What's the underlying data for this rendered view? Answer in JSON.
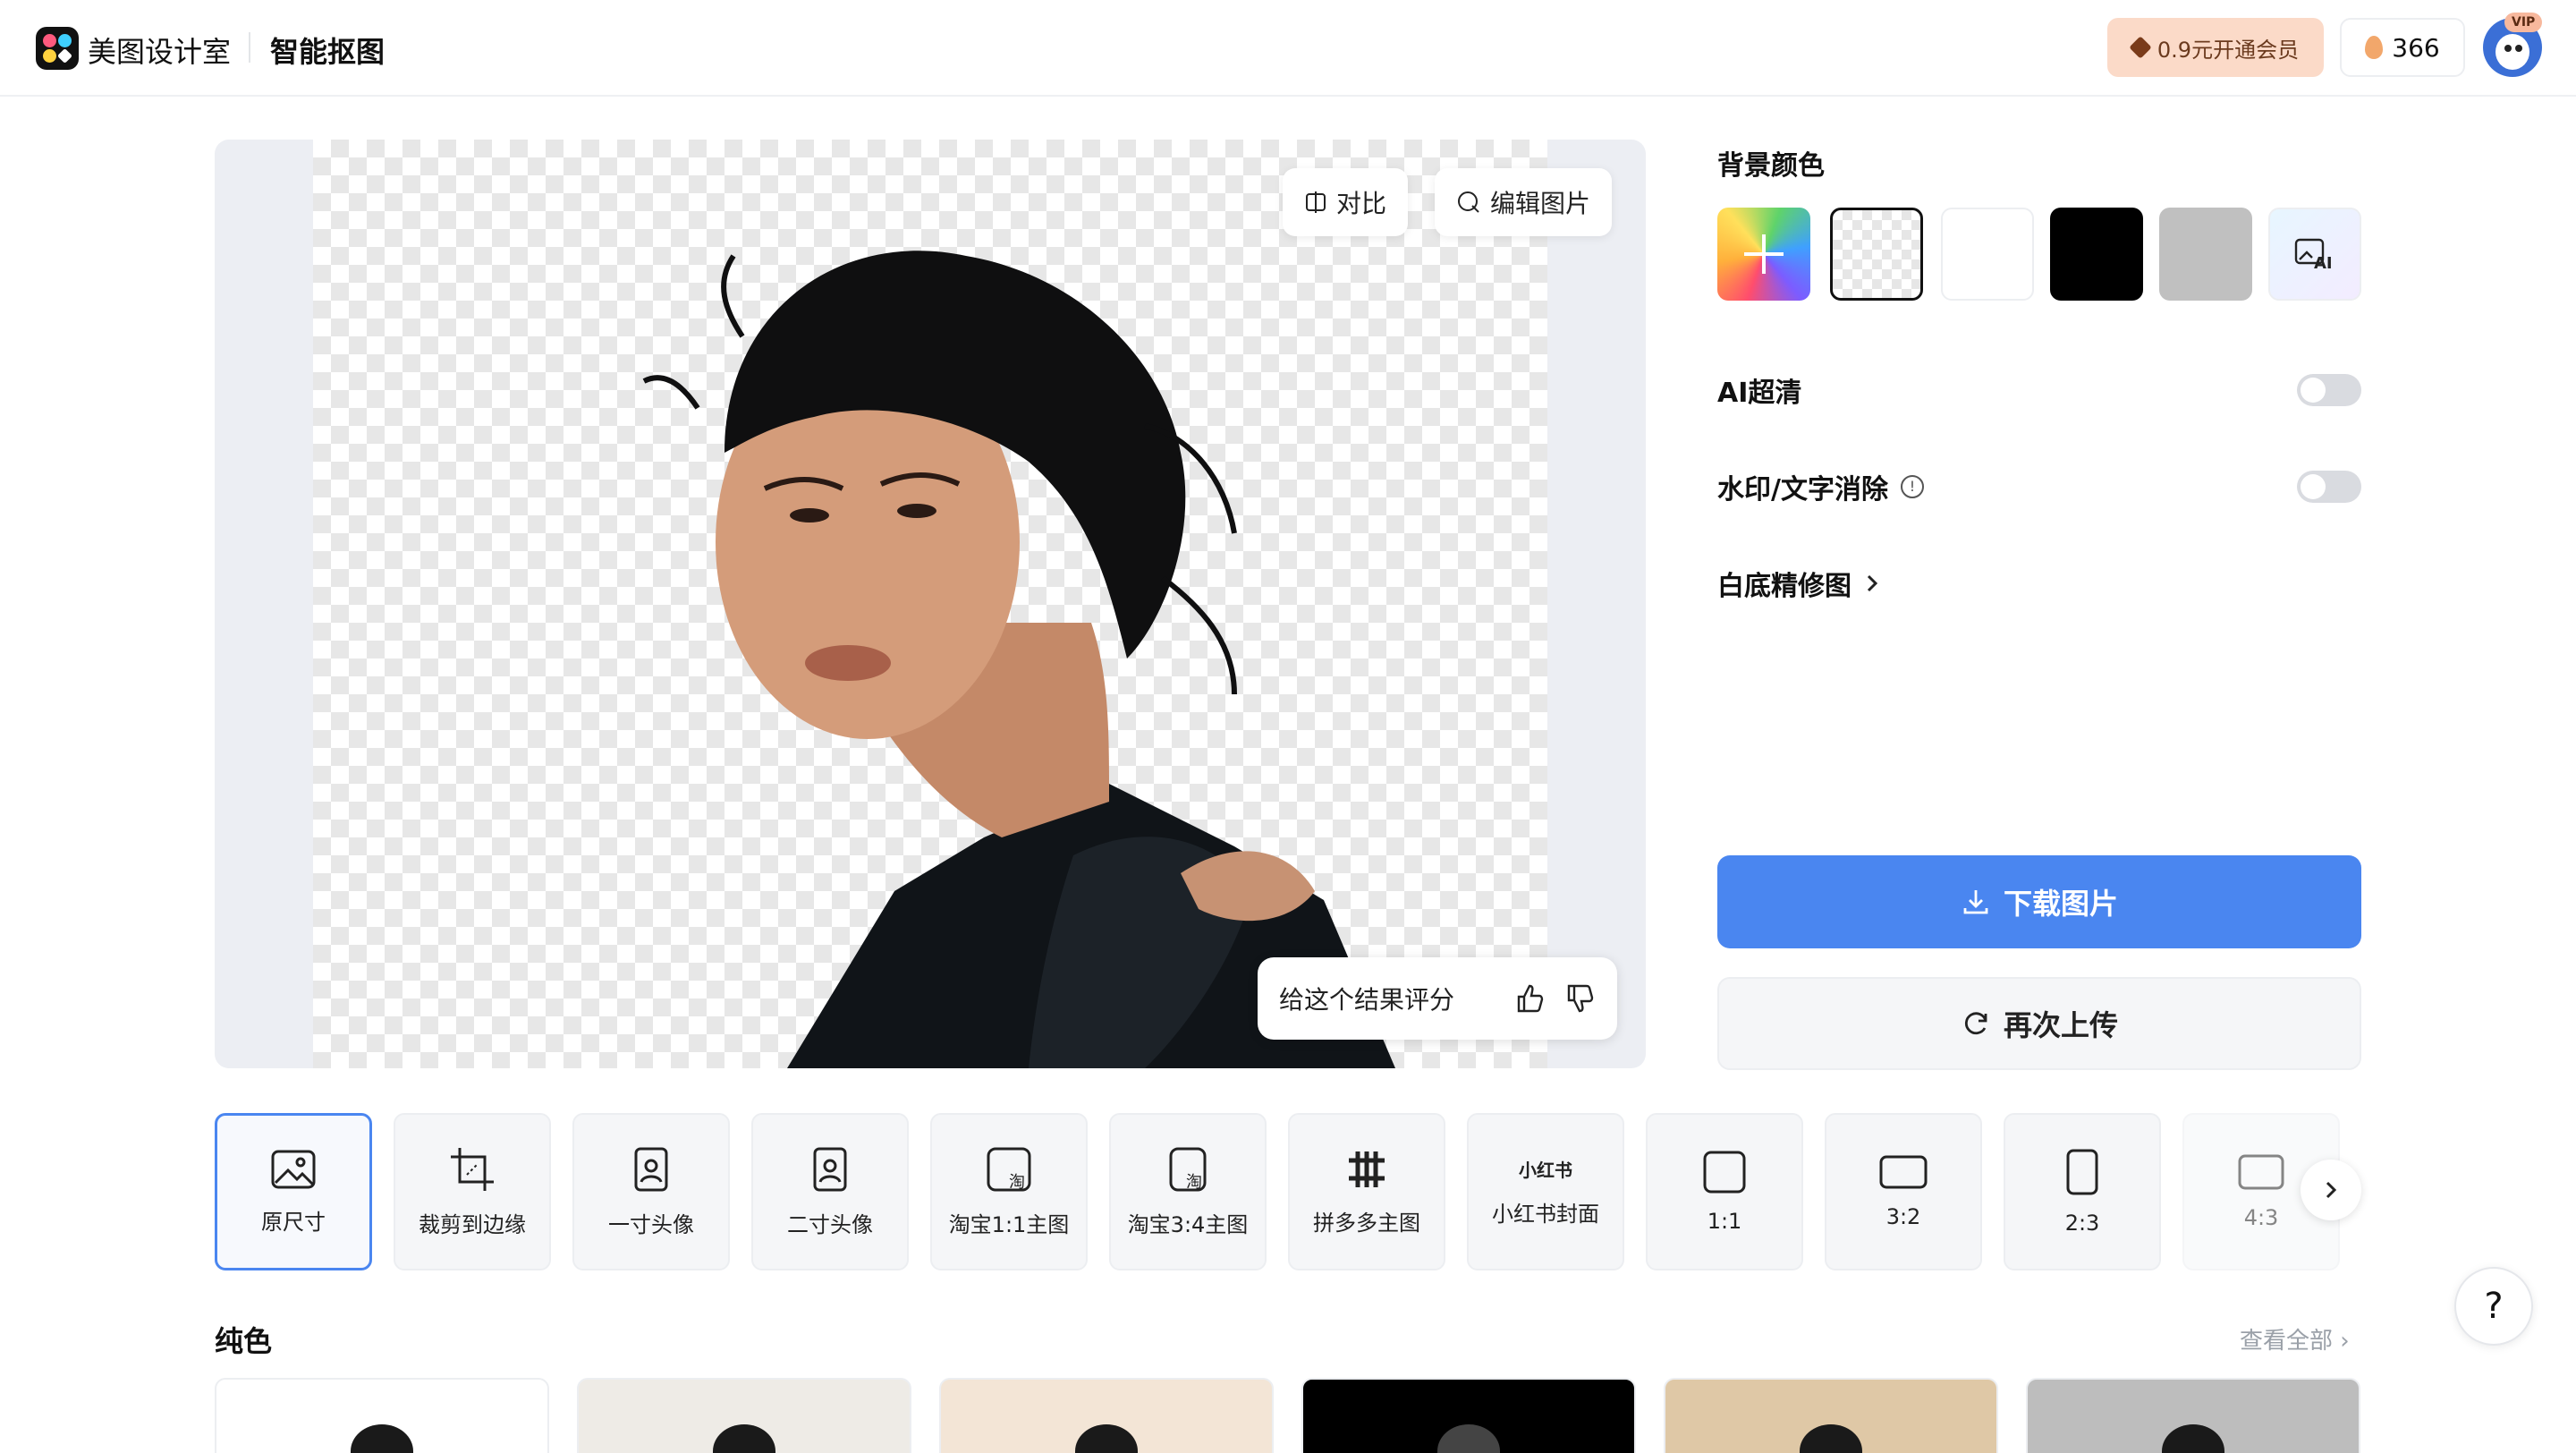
{
  "header": {
    "brand": "美图设计室",
    "product": "智能抠图",
    "vip_button": "0.9元开通会员",
    "credits": "366",
    "vip_tag": "VIP"
  },
  "canvas": {
    "compare_label": "对比",
    "edit_label": "编辑图片",
    "rating_prompt": "给这个结果评分"
  },
  "panel": {
    "bg_color_title": "背景颜色",
    "swatches": [
      {
        "name": "custom",
        "color": "gradient"
      },
      {
        "name": "transparent",
        "color": "transparent",
        "selected": true
      },
      {
        "name": "white",
        "color": "#ffffff"
      },
      {
        "name": "black",
        "color": "#000000"
      },
      {
        "name": "gray",
        "color": "#c0c0c0"
      },
      {
        "name": "ai",
        "color": "ai-background"
      }
    ],
    "ai_hd_label": "AI超清",
    "ai_hd_on": false,
    "watermark_label": "水印/文字消除",
    "watermark_on": false,
    "white_retouch_label": "白底精修图",
    "download_label": "下载图片",
    "reupload_label": "再次上传"
  },
  "presets": [
    {
      "label": "原尺寸",
      "icon": "image-icon",
      "active": true
    },
    {
      "label": "裁剪到边缘",
      "icon": "crop-icon"
    },
    {
      "label": "一寸头像",
      "icon": "portrait-icon"
    },
    {
      "label": "二寸头像",
      "icon": "portrait-icon"
    },
    {
      "label": "淘宝1:1主图",
      "icon": "taobao-square-icon"
    },
    {
      "label": "淘宝3:4主图",
      "icon": "taobao-portrait-icon"
    },
    {
      "label": "拼多多主图",
      "icon": "pinduoduo-icon"
    },
    {
      "label": "小红书封面",
      "icon": "xiaohongshu-icon",
      "icon_text": "小红书"
    },
    {
      "label": "1:1",
      "icon": "ratio-square-icon"
    },
    {
      "label": "3:2",
      "icon": "ratio-landscape-icon"
    },
    {
      "label": "2:3",
      "icon": "ratio-portrait-icon"
    },
    {
      "label": "4:3",
      "icon": "ratio-landscape-icon"
    }
  ],
  "bottom": {
    "section_title": "纯色",
    "see_all": "查看全部",
    "thumbnails": [
      "#ffffff",
      "#eeebe6",
      "#f3e5d6",
      "#000000",
      "#dfc8a6",
      "#bdbdbd"
    ]
  },
  "help": "?"
}
